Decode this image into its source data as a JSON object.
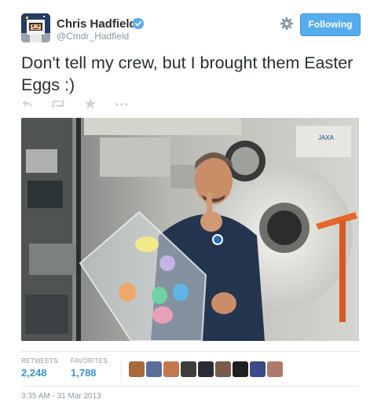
{
  "tweet": {
    "author_name": "Chris Hadfield",
    "author_handle": "@Cmdr_Hadfield",
    "follow_label": "Following",
    "text": "Don't tell my crew, but I brought them Easter Eggs :)",
    "timestamp": "3:35 AM - 31 Mar 2013"
  },
  "actions": [
    {
      "icon": "reply-icon"
    },
    {
      "icon": "retweet-icon"
    },
    {
      "icon": "favorite-icon"
    },
    {
      "icon": "more-icon"
    }
  ],
  "stats": {
    "retweets_label": "RETWEETS",
    "retweets_value": "2,248",
    "favorites_label": "FAVORITES",
    "favorites_value": "1,788"
  },
  "colors": {
    "accent": "#55acee",
    "link": "#3b94d9",
    "muted": "#8899a6",
    "text": "#292f33",
    "divider": "#e1e8ed"
  },
  "photo": {
    "subject": "astronaut-with-easter-eggs-photo"
  },
  "favoriters_avatar_count": 9
}
